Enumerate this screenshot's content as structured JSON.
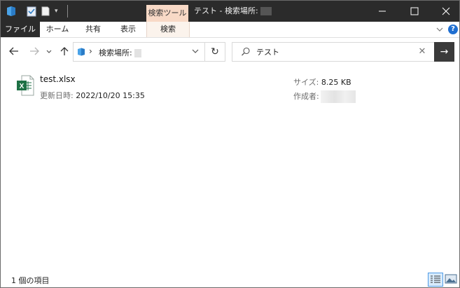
{
  "window": {
    "tool_tab": "検索ツール",
    "title": "テスト - 検索場所:"
  },
  "ribbon": {
    "tabs": [
      "ファイル",
      "ホーム",
      "共有",
      "表示",
      "検索"
    ]
  },
  "address": {
    "crumb": "検索場所:"
  },
  "search": {
    "value": "テスト"
  },
  "results": [
    {
      "name": "test.xlsx",
      "modified_label": "更新日時:",
      "modified_value": "2022/10/20 15:35",
      "size_label": "サイズ:",
      "size_value": "8.25 KB",
      "author_label": "作成者:"
    }
  ],
  "status": {
    "count": "1 個の項目"
  },
  "colors": {
    "titlebar": "#2b2b2b",
    "tool_tab": "#f8d9c6",
    "excel_green": "#1e7145",
    "accent": "#1f6fd1"
  },
  "icons": {
    "app": "folder-app-icon",
    "excel": "excel-file-icon",
    "search": "search-icon"
  }
}
